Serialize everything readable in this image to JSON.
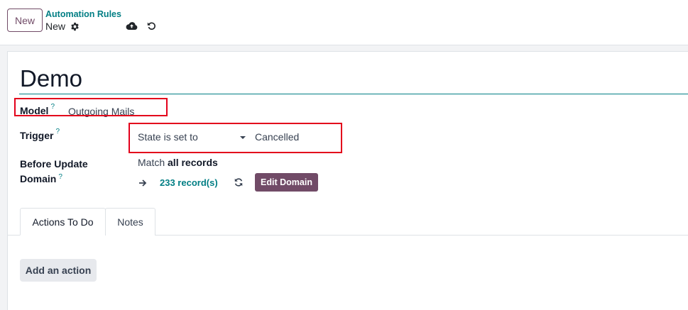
{
  "control_panel": {
    "new_button_label": "New",
    "breadcrumb": "Automation Rules",
    "record_name": "New"
  },
  "form": {
    "title": "Demo",
    "model": {
      "label": "Model",
      "help": "?",
      "value": "Outgoing Mails"
    },
    "trigger": {
      "label": "Trigger",
      "help": "?",
      "selected": "State is set to",
      "value": "Cancelled"
    },
    "domain": {
      "label_line1": "Before Update",
      "label_line2": "Domain",
      "help": "?",
      "match_prefix": "Match",
      "match_value": "all records",
      "records_count": "233 record(s)",
      "edit_button": "Edit Domain"
    },
    "tabs": [
      {
        "label": "Actions To Do",
        "active": true
      },
      {
        "label": "Notes",
        "active": false
      }
    ],
    "add_action_label": "Add an action"
  },
  "colors": {
    "brand": "#714b67",
    "link": "#017e84",
    "highlight": "#e3001b"
  },
  "icons": {
    "gear": "gear-icon",
    "save": "cloud-upload-icon",
    "discard": "undo-icon",
    "arrow": "arrow-right-icon",
    "refresh": "refresh-icon"
  }
}
